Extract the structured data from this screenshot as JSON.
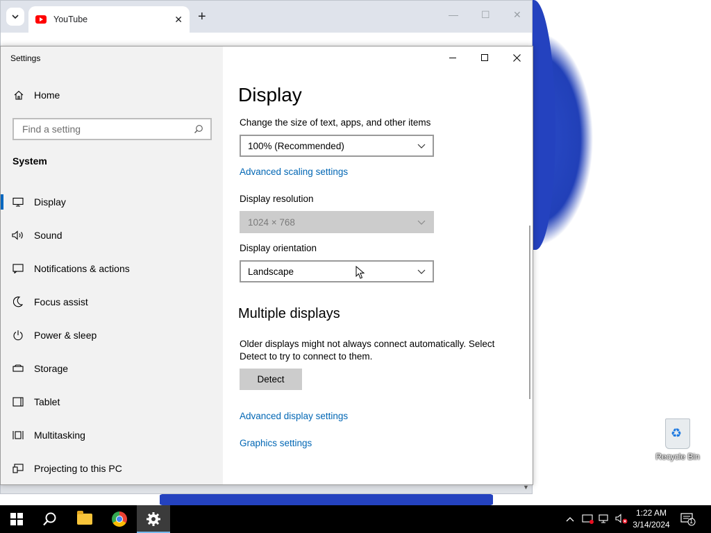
{
  "browser": {
    "tab_title": "YouTube",
    "new_tab": "+",
    "tab_close": "✕"
  },
  "settings": {
    "window_title": "Settings",
    "sidebar": {
      "home": "Home",
      "search_placeholder": "Find a setting",
      "section": "System",
      "items": [
        {
          "label": "Display",
          "icon": "monitor-icon",
          "active": true
        },
        {
          "label": "Sound",
          "icon": "speaker-icon"
        },
        {
          "label": "Notifications & actions",
          "icon": "notification-icon"
        },
        {
          "label": "Focus assist",
          "icon": "moon-icon"
        },
        {
          "label": "Power & sleep",
          "icon": "power-icon"
        },
        {
          "label": "Storage",
          "icon": "storage-icon"
        },
        {
          "label": "Tablet",
          "icon": "tablet-icon"
        },
        {
          "label": "Multitasking",
          "icon": "multitasking-icon"
        },
        {
          "label": "Projecting to this PC",
          "icon": "projecting-icon"
        }
      ]
    },
    "main": {
      "title": "Display",
      "scale_label": "Change the size of text, apps, and other items",
      "scale_value": "100% (Recommended)",
      "advanced_scaling": "Advanced scaling settings",
      "resolution_label": "Display resolution",
      "resolution_value": "1024 × 768",
      "orientation_label": "Display orientation",
      "orientation_value": "Landscape",
      "multiple_displays_title": "Multiple displays",
      "multiple_displays_text": "Older displays might not always connect automatically. Select Detect to try to connect to them.",
      "detect_button": "Detect",
      "advanced_display": "Advanced display settings",
      "graphics_settings": "Graphics settings"
    }
  },
  "desktop": {
    "recycle_bin": "Recycle Bin"
  },
  "taskbar": {
    "time": "1:22 AM",
    "date": "3/14/2024",
    "notification_count": "1"
  },
  "colors": {
    "accent": "#0067c0",
    "link": "#0066b4",
    "sidebar_bg": "#f2f2f2"
  }
}
